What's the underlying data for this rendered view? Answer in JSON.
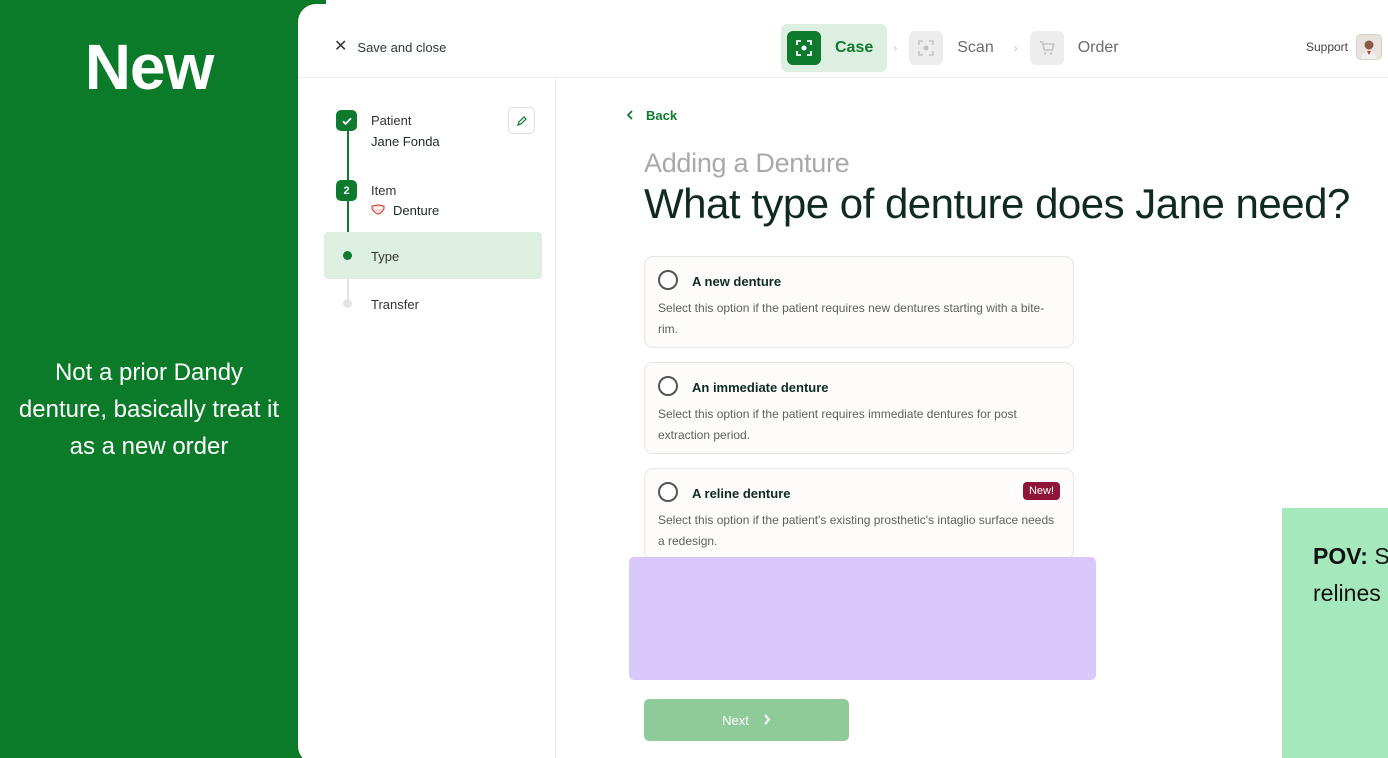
{
  "annotation_left": {
    "title": "New",
    "note": "Not a prior Dandy denture, basically treat it as a new order"
  },
  "header": {
    "close_label": "Save and close",
    "steps": [
      {
        "label": "Case",
        "state": "active",
        "icon": "scan-frame-icon"
      },
      {
        "label": "Scan",
        "state": "inactive",
        "icon": "scan-icon"
      },
      {
        "label": "Order",
        "state": "inactive",
        "icon": "cart-icon"
      }
    ],
    "support_label": "Support"
  },
  "sidebar": {
    "patient_label": "Patient",
    "patient_name": "Jane Fonda",
    "item_number": "2",
    "item_label": "Item",
    "item_value": "Denture",
    "type_label": "Type",
    "transfer_label": "Transfer"
  },
  "main": {
    "back_label": "Back",
    "subtitle": "Adding a Denture",
    "headline": "What type of denture does Jane need?",
    "options": [
      {
        "title": "A new denture",
        "description": "Select this option if the patient requires new dentures starting with a bite-rim."
      },
      {
        "title": "An immediate denture",
        "description": "Select this option if the patient requires immediate dentures for post extraction period."
      },
      {
        "title": "A reline denture",
        "description": "Select this option if the patient's existing prosthetic's intaglio surface needs a redesign.",
        "badge": "New!"
      }
    ],
    "next_label": "Next"
  },
  "annotation_right": {
    "pov_label": "POV:",
    "text": " S order, i presen additio relines doctor"
  },
  "colors": {
    "brand_green": "#0e7a2e",
    "annotation_green": "#0b7b2a",
    "active_step_bg": "#ddefe1",
    "new_badge": "#8e1538",
    "next_disabled": "#8fcb99",
    "placeholder_purple": "#d8c8fb",
    "pov_bg": "#a4e8bb"
  }
}
